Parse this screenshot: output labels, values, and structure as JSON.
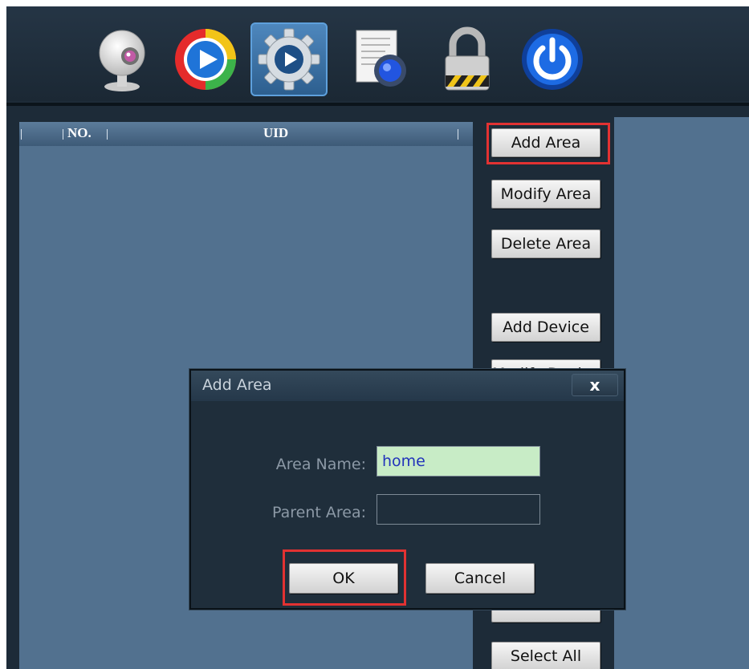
{
  "toolbar": {
    "icons": [
      "webcam-icon",
      "play-icon",
      "gear-play-icon",
      "document-gear-icon",
      "padlock-icon",
      "power-icon"
    ],
    "active_index": 2
  },
  "list": {
    "columns": [
      "NO.",
      "UID"
    ]
  },
  "side_buttons": {
    "add_area": "Add Area",
    "modify_area": "Modify Area",
    "delete_area": "Delete Area",
    "add_device": "Add Device",
    "modify_device": "Modify Device",
    "select_all": "Select All"
  },
  "dialog": {
    "title": "Add Area",
    "close": "x",
    "area_name_label": "Area Name:",
    "area_name_value": "home",
    "parent_area_label": "Parent Area:",
    "parent_area_value": "",
    "ok": "OK",
    "cancel": "Cancel"
  },
  "colors": {
    "highlight": "#e23232",
    "area_name_bg": "#c8ecc6",
    "panel": "#52718f"
  }
}
